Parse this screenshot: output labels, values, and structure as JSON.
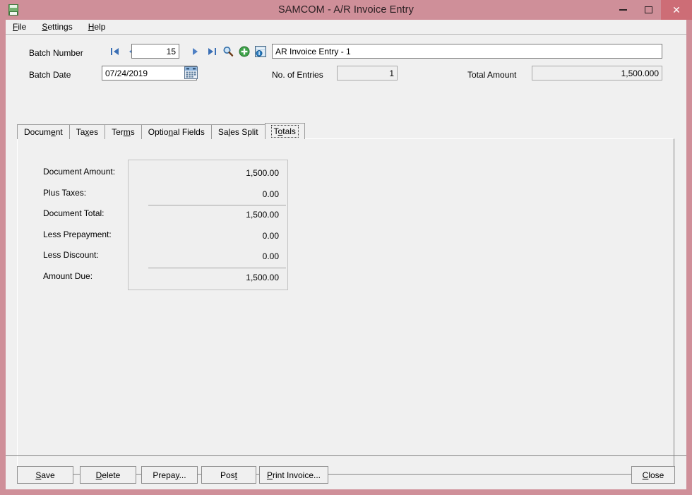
{
  "window": {
    "title": "SAMCOM - A/R Invoice Entry",
    "app_icon": "document-icon",
    "minimize_label": "–",
    "maximize_label": "□",
    "close_label": "✕",
    "frame_color": "#cf8f99",
    "close_button_color": "#cd6d76"
  },
  "menubar": {
    "items": [
      {
        "label": "File",
        "mnemonic": "F",
        "rest": "ile"
      },
      {
        "label": "Settings",
        "mnemonic": "S",
        "rest": "ettings"
      },
      {
        "label": "Help",
        "mnemonic": "H",
        "rest": "elp"
      }
    ]
  },
  "header": {
    "batch_number_label": "Batch Number",
    "batch_number_value": "15",
    "batch_date_label": "Batch Date",
    "batch_date_value": "07/24/2019",
    "description_value": "AR Invoice Entry - 1",
    "no_of_entries_label": "No. of Entries",
    "no_of_entries_value": "1",
    "total_amount_label": "Total Amount",
    "total_amount_value": "1,500.000",
    "nav": {
      "first_icon": "first-record-icon",
      "prev_icon": "previous-record-icon",
      "next_icon": "next-record-icon",
      "last_icon": "last-record-icon",
      "find_icon": "magnifier-search-icon",
      "new_icon": "add-new-icon",
      "info_icon": "properties-info-icon"
    },
    "calendar_icon": "calendar-icon"
  },
  "tabs": [
    {
      "pre": "Docum",
      "mnemonic": "e",
      "post": "nt",
      "selected": false
    },
    {
      "pre": "Ta",
      "mnemonic": "x",
      "post": "es",
      "selected": false
    },
    {
      "pre": "Ter",
      "mnemonic": "m",
      "post": "s",
      "selected": false
    },
    {
      "pre": "Optio",
      "mnemonic": "n",
      "post": "al Fields",
      "selected": false
    },
    {
      "pre": "Sa",
      "mnemonic": "l",
      "post": "es Split",
      "selected": false
    },
    {
      "pre": "T",
      "mnemonic": "o",
      "post": "tals",
      "selected": true
    }
  ],
  "totals": {
    "rows": [
      {
        "label": "Document Amount:",
        "value": "1,500.00",
        "ruled": false
      },
      {
        "label": "Plus Taxes:",
        "value": "0.00",
        "ruled": false
      },
      {
        "label": "Document Total:",
        "value": "1,500.00",
        "ruled": true
      },
      {
        "label": "Less Prepayment:",
        "value": "0.00",
        "ruled": false
      },
      {
        "label": "Less Discount:",
        "value": "0.00",
        "ruled": false
      },
      {
        "label": "Amount Due:",
        "value": "1,500.00",
        "ruled": true
      }
    ]
  },
  "buttons": {
    "save": {
      "mnemonic": "S",
      "rest": "ave"
    },
    "delete": {
      "mnemonic": "D",
      "rest": "elete"
    },
    "prepay": {
      "pre": "Prepa",
      "mnemonic": "y",
      "post": "..."
    },
    "post": {
      "pre": "Pos",
      "mnemonic": "t",
      "post": ""
    },
    "print": {
      "mnemonic": "P",
      "rest": "rint Invoice..."
    },
    "close": {
      "mnemonic": "C",
      "rest": "lose"
    }
  }
}
